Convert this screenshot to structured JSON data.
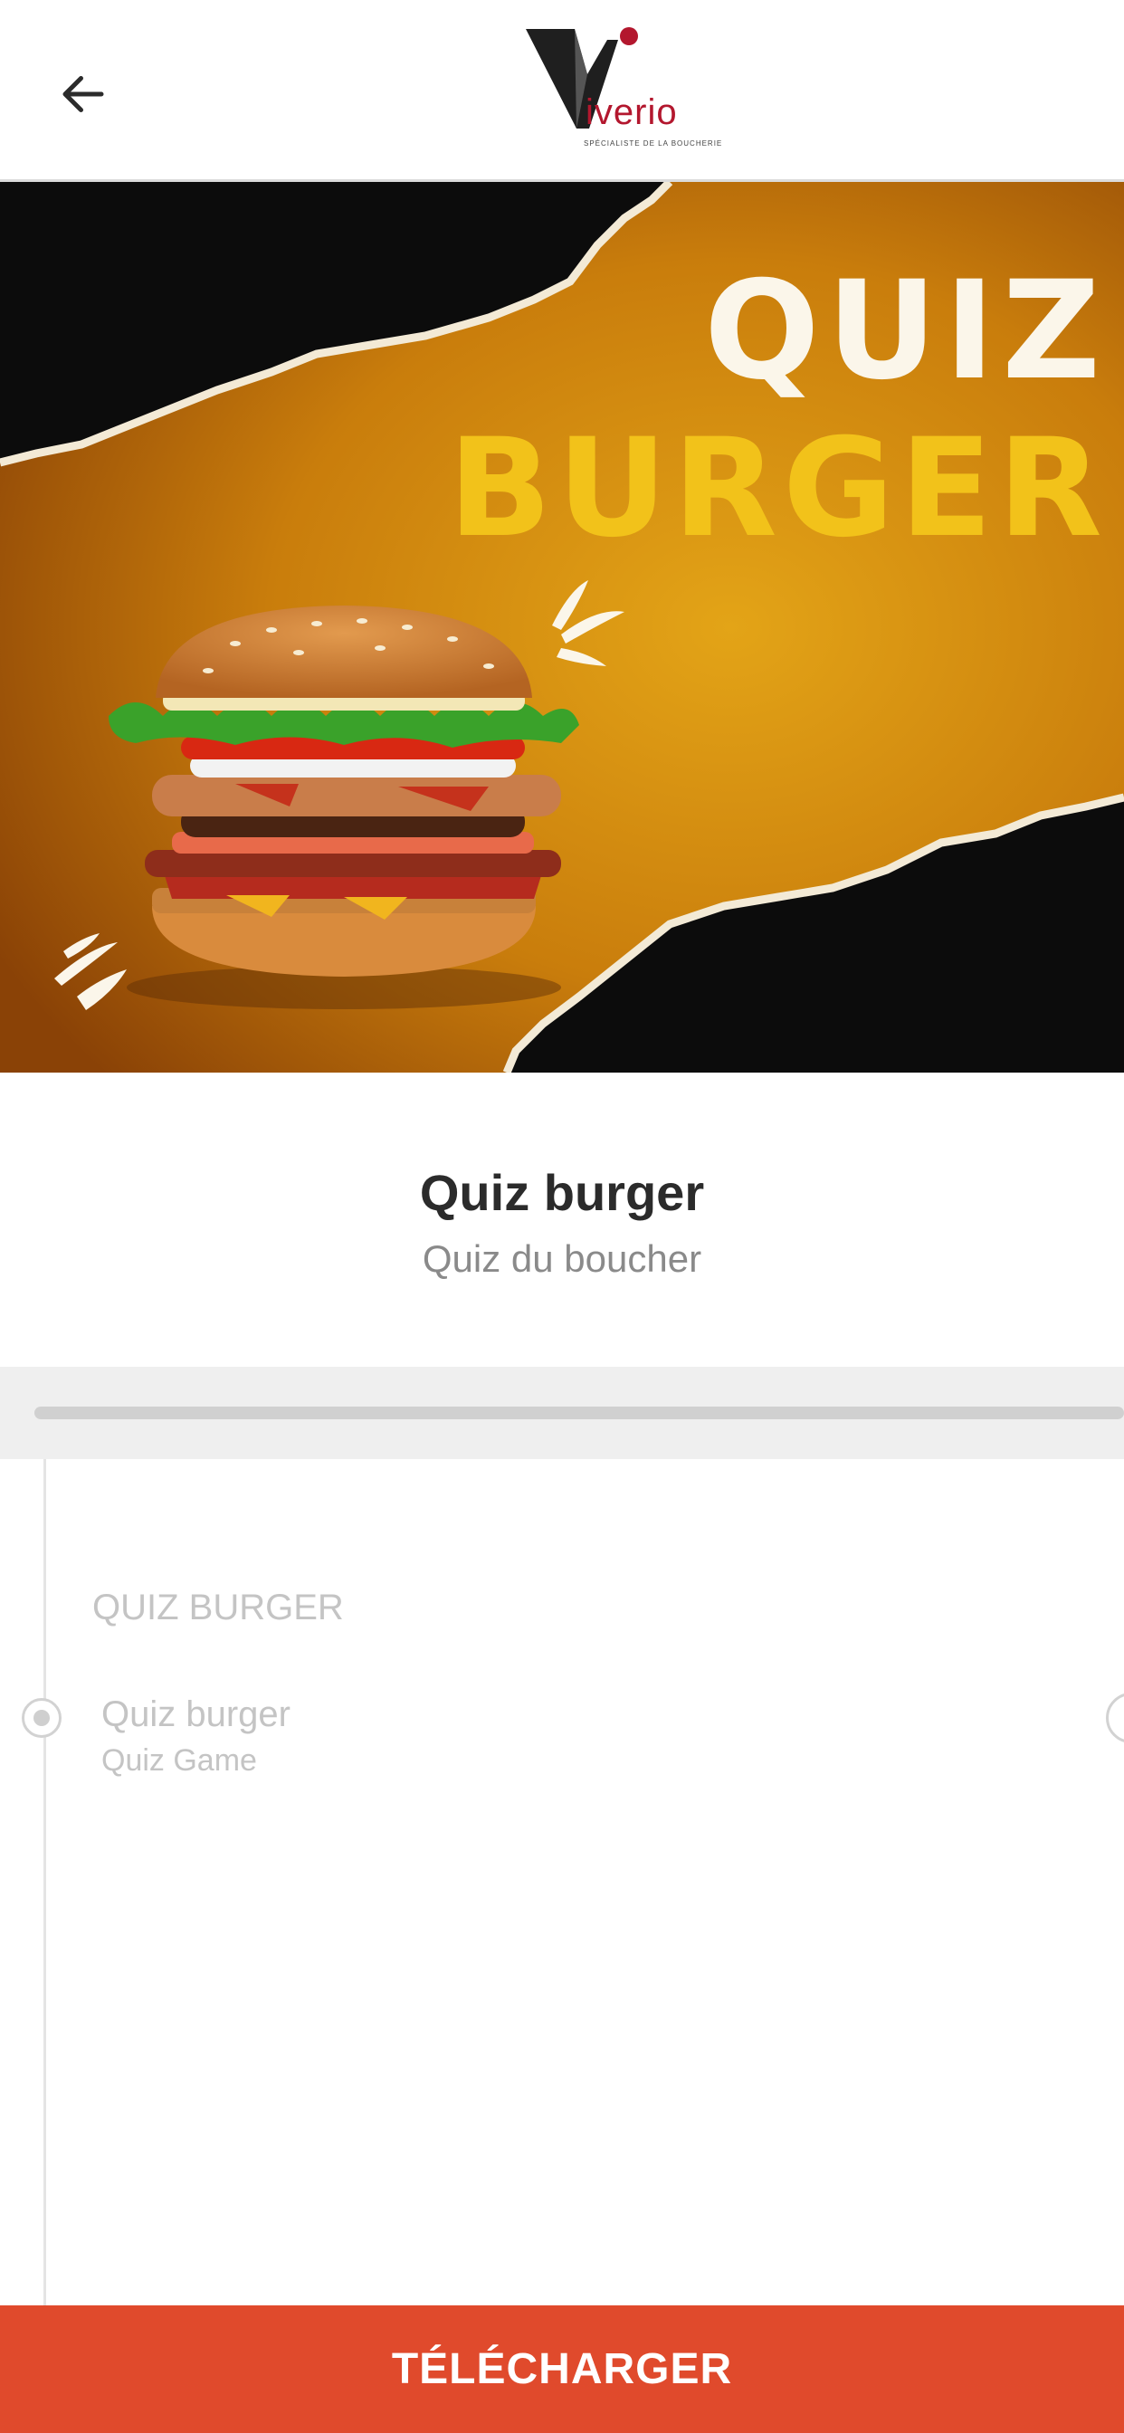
{
  "header": {
    "back_icon": "arrow-left-icon",
    "logo_word": "iverio",
    "logo_tagline": "SPÉCIALISTE DE LA BOUCHERIE",
    "brand_color": "#b3172e"
  },
  "hero": {
    "title_line1": "QUIZ",
    "title_line2": "BURGER",
    "title_line1_color": "#fbf6ea",
    "title_line2_color": "#f2c21a",
    "background_color": "#d08a0f"
  },
  "quiz": {
    "title": "Quiz burger",
    "subtitle": "Quiz du boucher",
    "progress": 0
  },
  "list": {
    "section_label": "QUIZ BURGER",
    "items": [
      {
        "title": "Quiz burger",
        "subtitle": "Quiz Game"
      }
    ]
  },
  "footer": {
    "download_label": "TÉLÉCHARGER",
    "button_color": "#e04a2c"
  }
}
